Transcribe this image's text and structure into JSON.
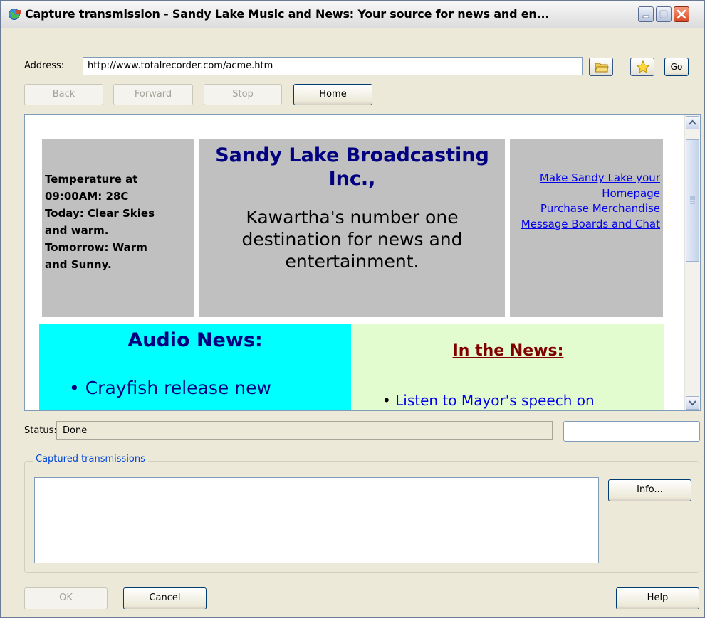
{
  "window": {
    "title": "Capture transmission  - Sandy Lake Music and News: Your source for news and en...",
    "controls": [
      "minimize-icon",
      "maximize-icon",
      "close-icon"
    ]
  },
  "address": {
    "label": "Address:",
    "value": "http://www.totalrecorder.com/acme.htm",
    "go_label": "Go",
    "folder_icon": "folder-icon",
    "favorite_icon": "star-icon"
  },
  "nav": {
    "back": "Back",
    "forward": "Forward",
    "stop": "Stop",
    "home": "Home"
  },
  "page": {
    "weather": [
      "Temperature at",
      "09:00AM: 28C",
      "Today: Clear Skies",
      "and warm.",
      "Tomorrow: Warm",
      "and Sunny."
    ],
    "header_title": "Sandy Lake Broadcasting Inc.,",
    "header_tagline": "Kawartha's number one destination for news and entertainment.",
    "links": [
      "Make Sandy Lake your Homepage",
      "Purchase Merchandise",
      "Message Boards and Chat"
    ],
    "audio_heading": "Audio News:",
    "audio_item": "Crayfish release new",
    "news_heading": "In the News:",
    "news_item": "Listen to Mayor's speech on"
  },
  "status": {
    "label": "Status:",
    "value": "Done"
  },
  "captured": {
    "legend": "Captured transmissions",
    "info_label": "Info..."
  },
  "footer": {
    "ok": "OK",
    "cancel": "Cancel",
    "help": "Help"
  },
  "colors": {
    "audio_bg": "#00ffff",
    "news_bg": "#e2fbcf",
    "panel_bg": "#c0c0c0",
    "heading_blue": "#000080",
    "news_heading": "#800000",
    "link": "#0000ee"
  }
}
